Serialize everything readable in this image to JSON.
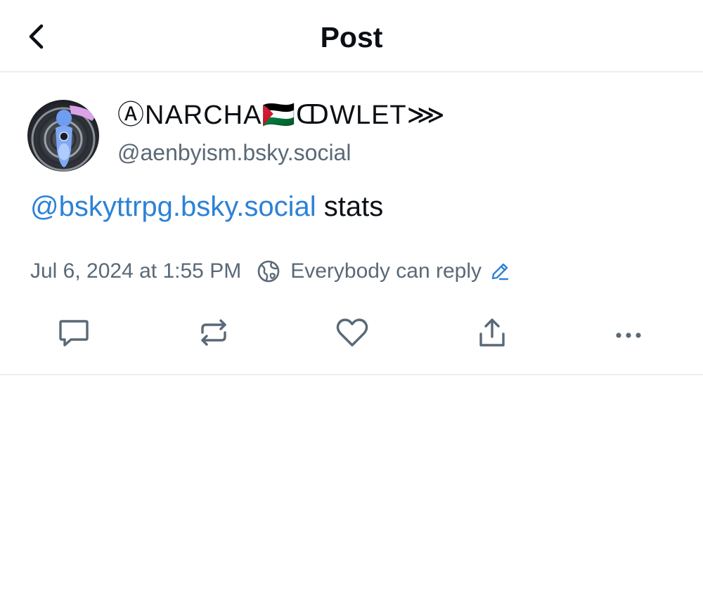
{
  "header": {
    "title": "Post",
    "back_icon": "chevron-left-icon"
  },
  "post": {
    "author": {
      "display_name": "ⒶNARCHA🇵🇸ↀWLET⋙",
      "handle": "@aenbyism.bsky.social"
    },
    "text": {
      "mention": "@bskyttrpg.bsky.social",
      "body": " stats"
    },
    "timestamp": "Jul 6, 2024 at 1:55 PM",
    "reply_setting": "Everybody can reply",
    "actions": [
      {
        "name": "reply",
        "icon": "comment-icon"
      },
      {
        "name": "repost",
        "icon": "repost-icon"
      },
      {
        "name": "like",
        "icon": "heart-icon"
      },
      {
        "name": "share",
        "icon": "share-icon"
      },
      {
        "name": "more",
        "icon": "more-icon"
      }
    ]
  },
  "colors": {
    "text": "#0b0f14",
    "muted": "#5a6977",
    "link": "#2c82d6",
    "divider": "#eceff2",
    "icon": "#5a6977"
  }
}
